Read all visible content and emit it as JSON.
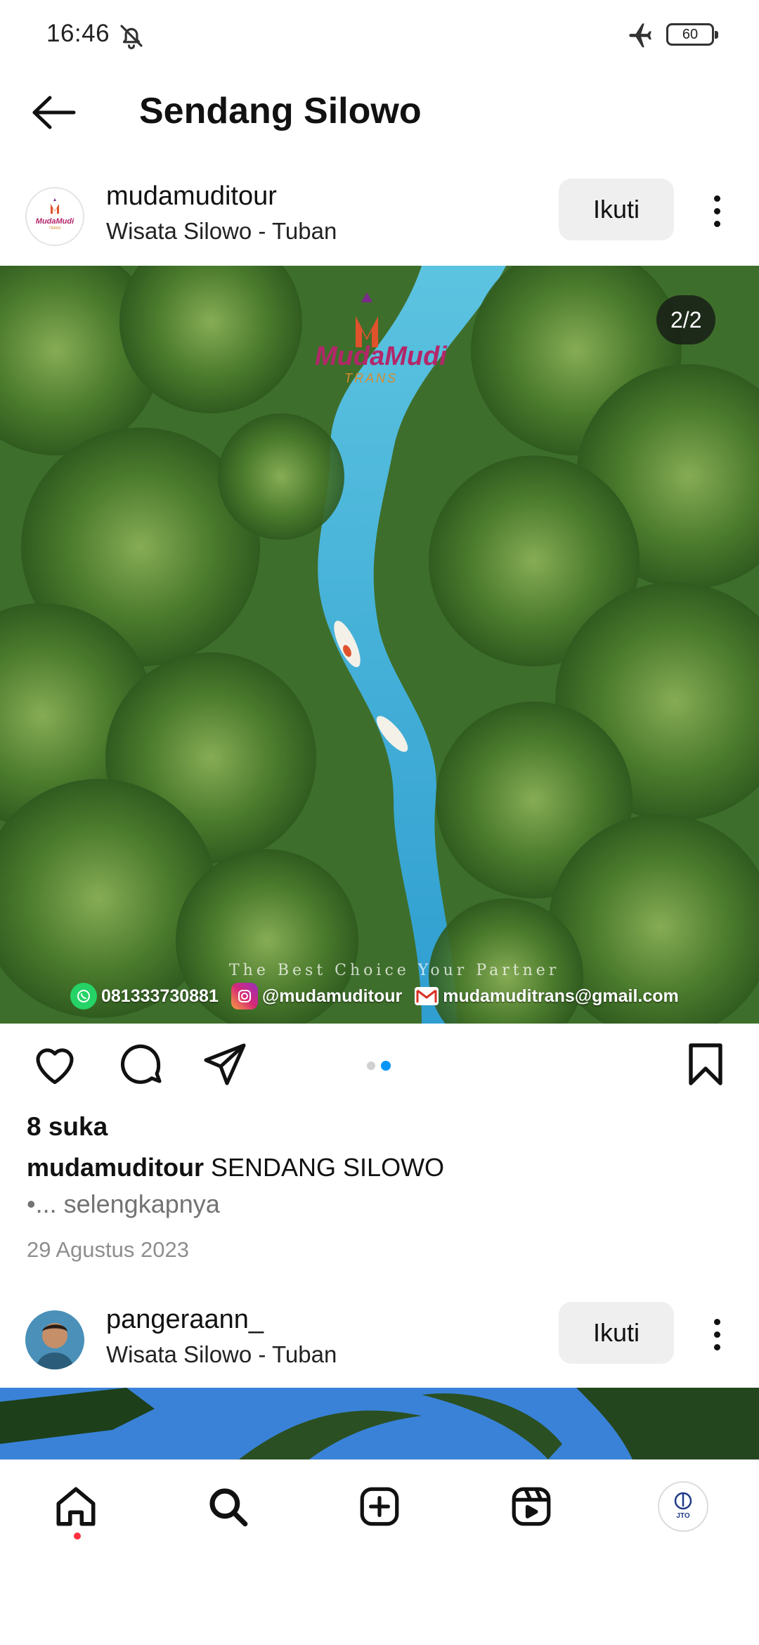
{
  "status_bar": {
    "time": "16:46",
    "battery": "60",
    "icons": [
      "mute-icon",
      "airplane-icon",
      "battery-icon"
    ]
  },
  "header": {
    "title": "Sendang Silowo",
    "back_icon": "arrow-left-icon"
  },
  "post1": {
    "username": "mudamuditour",
    "location": "Wisata Silowo - Tuban",
    "follow_label": "Ikuti",
    "image_counter": "2/2",
    "logo_text": "MudaMudi",
    "logo_sub": "TRANS",
    "tagline": "The Best Choice Your Partner",
    "contact_phone": "081333730881",
    "contact_instagram": "@mudamuditour",
    "contact_email": "mudamuditrans@gmail.com",
    "likes": "8 suka",
    "caption_user": "mudamuditour",
    "caption_text": "SENDANG SILOWO",
    "more_link": "•... selengkapnya",
    "date": "29 Agustus 2023",
    "carousel": {
      "count": 2,
      "active": 2
    }
  },
  "post2": {
    "username": "pangeraann_",
    "location": "Wisata Silowo - Tuban",
    "follow_label": "Ikuti"
  },
  "bottom_nav": [
    "home-icon",
    "search-icon",
    "create-icon",
    "reels-icon",
    "profile-avatar"
  ],
  "profile_avatar_text": "JTO",
  "colors": {
    "accent": "#0095f6",
    "notification": "#ff3040",
    "button_bg": "#efefef"
  }
}
